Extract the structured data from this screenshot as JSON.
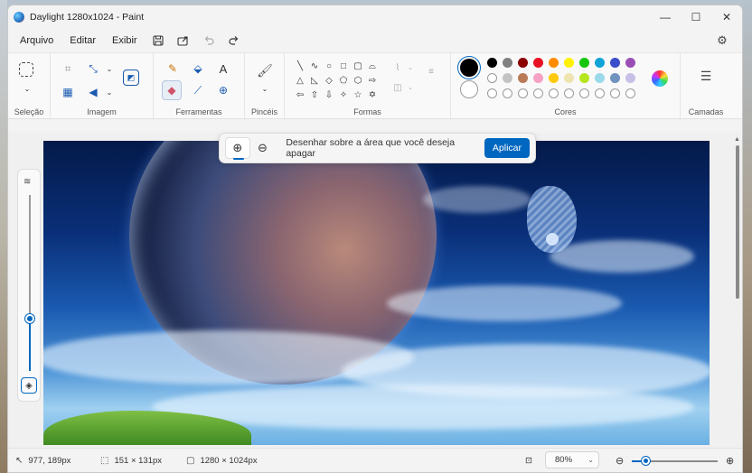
{
  "window": {
    "title": "Daylight 1280x1024 - Paint",
    "controls": {
      "minimize": "—",
      "maximize": "☐",
      "close": "✕"
    }
  },
  "menu": {
    "items": [
      "Arquivo",
      "Editar",
      "Exibir"
    ],
    "icons": [
      "save-icon",
      "share-icon",
      "undo-icon",
      "redo-icon",
      "settings-icon"
    ]
  },
  "ribbon": {
    "groups": {
      "selection": "Seleção",
      "image": "Imagem",
      "tools": "Ferramentas",
      "brushes": "Pincéis",
      "shapes": "Formas",
      "colors": "Cores",
      "layers": "Camadas"
    },
    "colors": {
      "primary": "#000000",
      "secondary": "#ffffff",
      "row1": [
        "#000000",
        "#808080",
        "#8b0000",
        "#e81123",
        "#ff8c00",
        "#fff100",
        "#16c60c",
        "#0fa3d6",
        "#3a4ecb",
        "#9b4fb5"
      ],
      "row2": [
        "#ffffff",
        "#c3c3c3",
        "#b97a57",
        "#f7a1c4",
        "#ffc90e",
        "#efe4b0",
        "#b5e61d",
        "#99d9ea",
        "#7092be",
        "#c8bfe7"
      ]
    }
  },
  "eraseBar": {
    "message": "Desenhar sobre a área que você deseja apagar",
    "apply": "Aplicar"
  },
  "status": {
    "cursor": "977, 189px",
    "selection": "151 × 131px",
    "canvas": "1280 × 1024px",
    "zoom": "80%"
  }
}
